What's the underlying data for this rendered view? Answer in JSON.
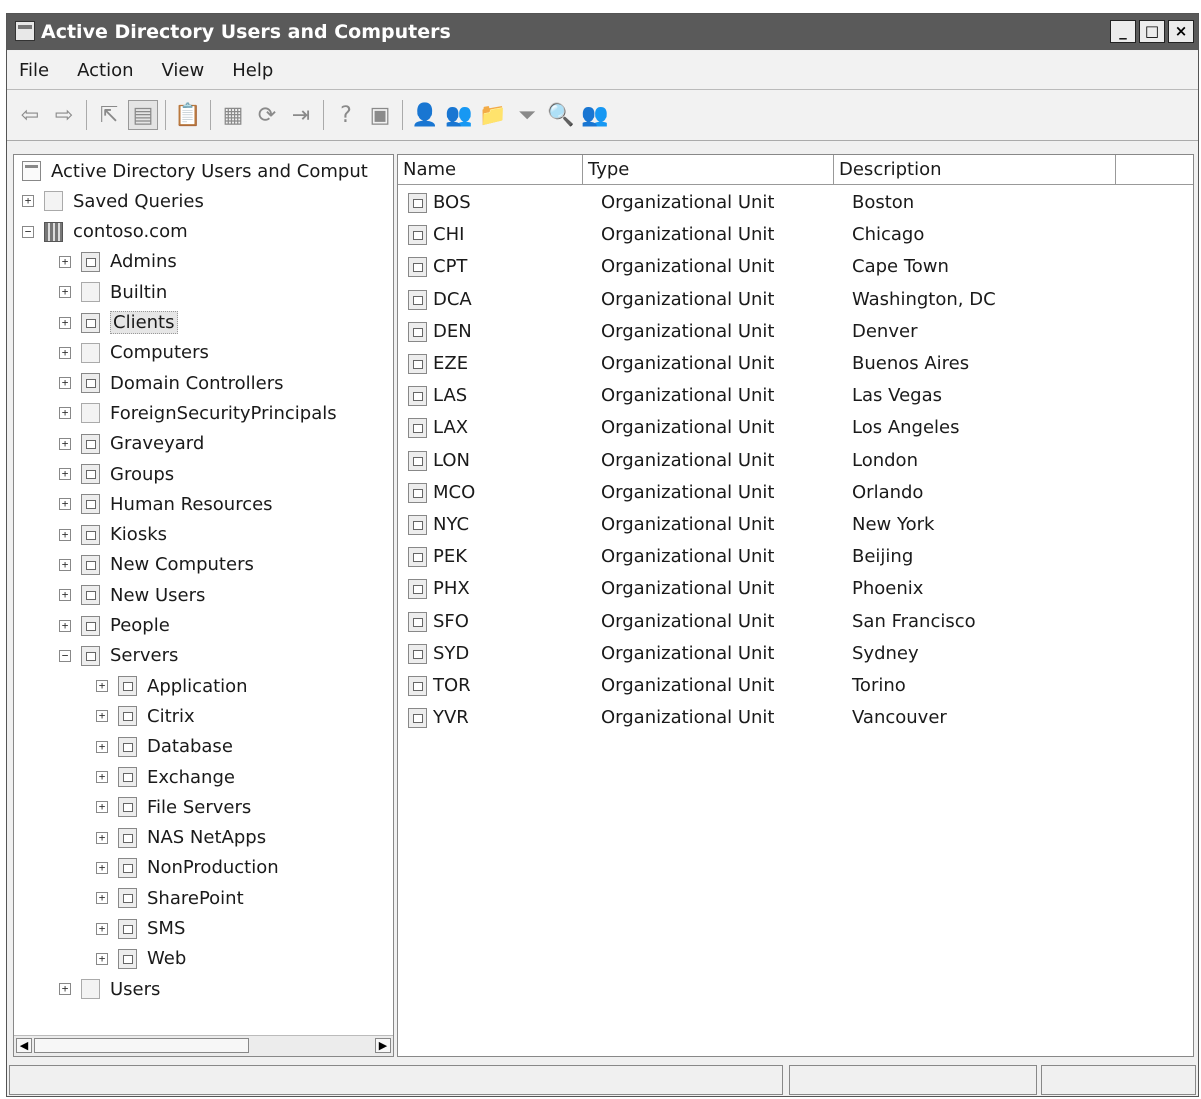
{
  "window": {
    "title": "Active Directory Users and Computers",
    "minimize": "_",
    "maximize": "□",
    "close": "×"
  },
  "menu": [
    "File",
    "Action",
    "View",
    "Help"
  ],
  "toolbar": [
    {
      "icon": "back-arrow-icon",
      "glyph": "⇦"
    },
    {
      "icon": "forward-arrow-icon",
      "glyph": "⇨"
    },
    {
      "sep": true
    },
    {
      "icon": "up-folder-icon",
      "glyph": "⇱"
    },
    {
      "icon": "show-console-tree-icon",
      "glyph": "▤",
      "pressed": true
    },
    {
      "sep": true
    },
    {
      "icon": "clipboard-icon",
      "glyph": "📋"
    },
    {
      "sep": true
    },
    {
      "icon": "properties-icon",
      "glyph": "▦"
    },
    {
      "icon": "refresh-icon",
      "glyph": "⟳"
    },
    {
      "icon": "export-list-icon",
      "glyph": "⇥"
    },
    {
      "sep": true
    },
    {
      "icon": "help-icon",
      "glyph": "?"
    },
    {
      "icon": "action-pane-icon",
      "glyph": "▣"
    },
    {
      "sep": true
    },
    {
      "icon": "new-user-icon",
      "glyph": "👤"
    },
    {
      "icon": "new-group-icon",
      "glyph": "👥"
    },
    {
      "icon": "new-ou-icon",
      "glyph": "📁"
    },
    {
      "icon": "filter-icon",
      "glyph": "⏷"
    },
    {
      "icon": "find-icon",
      "glyph": "🔍"
    },
    {
      "icon": "add-to-group-icon",
      "glyph": "👥"
    }
  ],
  "tree": [
    {
      "label": "Active Directory Users and Comput",
      "level": 0,
      "toggle": "",
      "icon": "root"
    },
    {
      "label": "Saved Queries",
      "level": 1,
      "toggle": "+",
      "icon": "folder"
    },
    {
      "label": "contoso.com",
      "level": 1,
      "toggle": "−",
      "icon": "domain"
    },
    {
      "label": "Admins",
      "level": 2,
      "toggle": "+",
      "icon": "ou"
    },
    {
      "label": "Builtin",
      "level": 2,
      "toggle": "+",
      "icon": "folder"
    },
    {
      "label": "Clients",
      "level": 2,
      "toggle": "+",
      "icon": "ou",
      "selected": true
    },
    {
      "label": "Computers",
      "level": 2,
      "toggle": "+",
      "icon": "folder"
    },
    {
      "label": "Domain Controllers",
      "level": 2,
      "toggle": "+",
      "icon": "ou"
    },
    {
      "label": "ForeignSecurityPrincipals",
      "level": 2,
      "toggle": "+",
      "icon": "folder"
    },
    {
      "label": "Graveyard",
      "level": 2,
      "toggle": "+",
      "icon": "ou"
    },
    {
      "label": "Groups",
      "level": 2,
      "toggle": "+",
      "icon": "ou"
    },
    {
      "label": "Human Resources",
      "level": 2,
      "toggle": "+",
      "icon": "ou"
    },
    {
      "label": "Kiosks",
      "level": 2,
      "toggle": "+",
      "icon": "ou"
    },
    {
      "label": "New Computers",
      "level": 2,
      "toggle": "+",
      "icon": "ou"
    },
    {
      "label": "New Users",
      "level": 2,
      "toggle": "+",
      "icon": "ou"
    },
    {
      "label": "People",
      "level": 2,
      "toggle": "+",
      "icon": "ou"
    },
    {
      "label": "Servers",
      "level": 2,
      "toggle": "−",
      "icon": "ou"
    },
    {
      "label": "Application",
      "level": 3,
      "toggle": "+",
      "icon": "ou"
    },
    {
      "label": "Citrix",
      "level": 3,
      "toggle": "+",
      "icon": "ou"
    },
    {
      "label": "Database",
      "level": 3,
      "toggle": "+",
      "icon": "ou"
    },
    {
      "label": "Exchange",
      "level": 3,
      "toggle": "+",
      "icon": "ou"
    },
    {
      "label": "File Servers",
      "level": 3,
      "toggle": "+",
      "icon": "ou"
    },
    {
      "label": "NAS NetApps",
      "level": 3,
      "toggle": "+",
      "icon": "ou"
    },
    {
      "label": "NonProduction",
      "level": 3,
      "toggle": "+",
      "icon": "ou"
    },
    {
      "label": "SharePoint",
      "level": 3,
      "toggle": "+",
      "icon": "ou"
    },
    {
      "label": "SMS",
      "level": 3,
      "toggle": "+",
      "icon": "ou"
    },
    {
      "label": "Web",
      "level": 3,
      "toggle": "+",
      "icon": "ou"
    },
    {
      "label": "Users",
      "level": 2,
      "toggle": "+",
      "icon": "folder"
    }
  ],
  "list": {
    "columns": [
      "Name",
      "Type",
      "Description"
    ],
    "rows": [
      {
        "name": "BOS",
        "type": "Organizational Unit",
        "description": "Boston"
      },
      {
        "name": "CHI",
        "type": "Organizational Unit",
        "description": "Chicago"
      },
      {
        "name": "CPT",
        "type": "Organizational Unit",
        "description": "Cape Town"
      },
      {
        "name": "DCA",
        "type": "Organizational Unit",
        "description": "Washington, DC"
      },
      {
        "name": "DEN",
        "type": "Organizational Unit",
        "description": "Denver"
      },
      {
        "name": "EZE",
        "type": "Organizational Unit",
        "description": "Buenos Aires"
      },
      {
        "name": "LAS",
        "type": "Organizational Unit",
        "description": "Las Vegas"
      },
      {
        "name": "LAX",
        "type": "Organizational Unit",
        "description": "Los Angeles"
      },
      {
        "name": "LON",
        "type": "Organizational Unit",
        "description": "London"
      },
      {
        "name": "MCO",
        "type": "Organizational Unit",
        "description": "Orlando"
      },
      {
        "name": "NYC",
        "type": "Organizational Unit",
        "description": "New York"
      },
      {
        "name": "PEK",
        "type": "Organizational Unit",
        "description": "Beijing"
      },
      {
        "name": "PHX",
        "type": "Organizational Unit",
        "description": "Phoenix"
      },
      {
        "name": "SFO",
        "type": "Organizational Unit",
        "description": "San Francisco"
      },
      {
        "name": "SYD",
        "type": "Organizational Unit",
        "description": "Sydney"
      },
      {
        "name": "TOR",
        "type": "Organizational Unit",
        "description": "Torino"
      },
      {
        "name": "YVR",
        "type": "Organizational Unit",
        "description": "Vancouver"
      }
    ]
  },
  "scroll": {
    "left": "◀",
    "right": "▶"
  }
}
